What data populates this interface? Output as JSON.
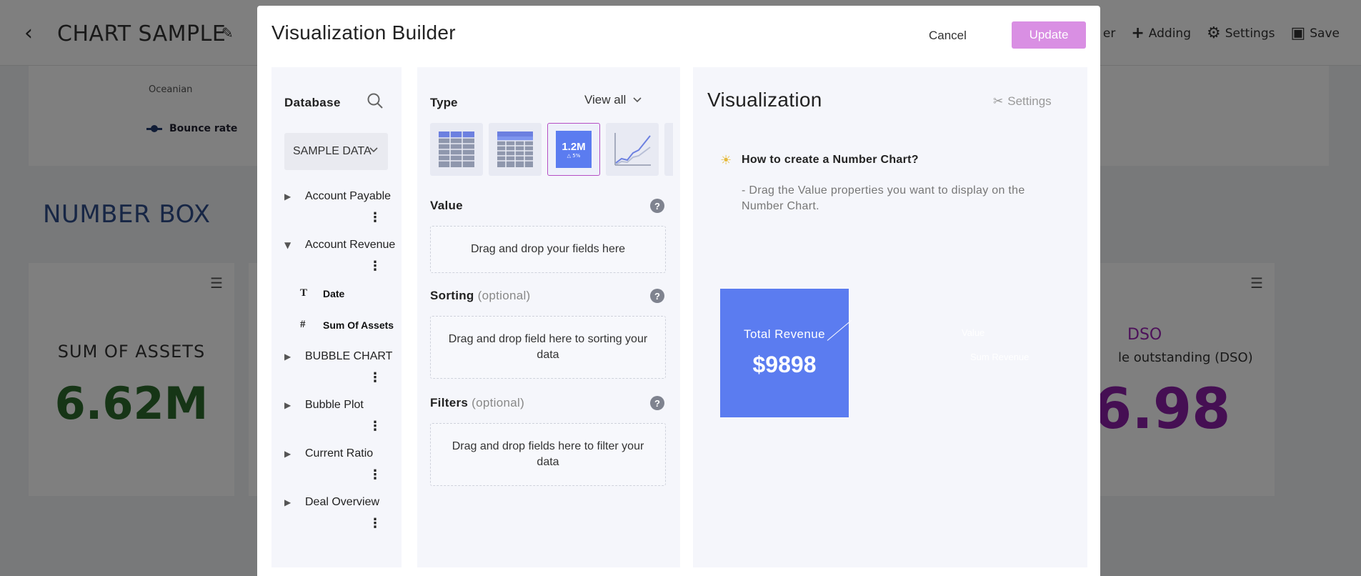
{
  "background": {
    "title": "CHART SAMPLE",
    "actions": [
      {
        "label": "er",
        "icon": "filter-icon"
      },
      {
        "label": "Adding",
        "icon": "plus-icon"
      },
      {
        "label": "Settings",
        "icon": "gear-icon"
      },
      {
        "label": "Save",
        "icon": "save-icon"
      }
    ],
    "chart_top": {
      "category_label": "Oceanian",
      "legend": [
        "Bounce rate"
      ]
    },
    "section_title": "NUMBER BOX",
    "card_assets": {
      "title": "SUM OF ASSETS",
      "value": "6.62M"
    },
    "card_dso": {
      "title": "DSO",
      "subtitle": "le outstanding (DSO)",
      "value": "6.98"
    },
    "colors": {
      "assets_value": "#2d6a2d",
      "dso": "#8b1ea6",
      "section": "#2e4d8b"
    }
  },
  "modal": {
    "title": "Visualization Builder",
    "cancel_label": "Cancel",
    "update_label": "Update",
    "colors": {
      "update": "#d98fe3",
      "accent": "#5b7cf0",
      "selected_border": "#b54fc4"
    }
  },
  "database": {
    "label": "Database",
    "selected": "SAMPLE DATA",
    "tree": [
      {
        "label": "Account Payable",
        "expanded": false
      },
      {
        "label": "Account Revenue",
        "expanded": true,
        "children": [
          {
            "type_icon": "T",
            "label": "Date"
          },
          {
            "type_icon": "#",
            "label": "Sum Of Assets"
          }
        ]
      },
      {
        "label": "BUBBLE CHART",
        "expanded": false
      },
      {
        "label": "Bubble Plot",
        "expanded": false
      },
      {
        "label": "Current Ratio",
        "expanded": false
      },
      {
        "label": "Deal Overview",
        "expanded": false
      }
    ]
  },
  "type_panel": {
    "label": "Type",
    "view_all": "View all",
    "types": [
      {
        "name": "table",
        "icon": "table-icon"
      },
      {
        "name": "pivot-table",
        "icon": "pivot-table-icon"
      },
      {
        "name": "number",
        "icon": "number-chart-icon",
        "selected": true,
        "preview_big": "1.2M",
        "preview_small": "△ 5%"
      },
      {
        "name": "line",
        "icon": "line-chart-icon"
      }
    ],
    "value": {
      "label": "Value",
      "placeholder": "Drag and drop your fields here"
    },
    "sorting": {
      "label": "Sorting",
      "optional": "(optional)",
      "placeholder": "Drag and drop field here to sorting your data"
    },
    "filters": {
      "label": "Filters",
      "optional": "(optional)",
      "placeholder": "Drag and drop fields here to filter your data"
    }
  },
  "visualization": {
    "title": "Visualization",
    "settings_label": "Settings",
    "howto_title": "How to create a Number Chart?",
    "howto_desc": "- Drag the Value properties you want to display on the Number Chart.",
    "preview": {
      "label": "Total Revenue",
      "value": "$9898"
    },
    "annotations": {
      "value": "Value",
      "sum": "Sum Revenue"
    }
  }
}
